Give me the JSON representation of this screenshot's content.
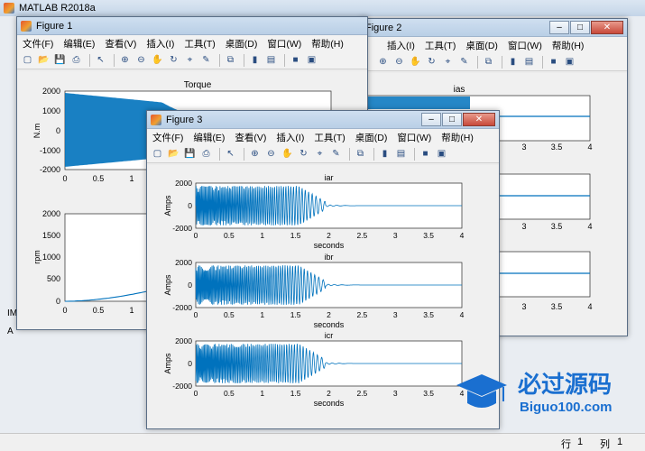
{
  "main_window": {
    "title": "MATLAB R2018a",
    "status": {
      "row_label": "行",
      "row_value": "1",
      "col_label": "列",
      "col_value": "1"
    },
    "side_text_1": "IM",
    "side_text_2": "A"
  },
  "figures": [
    {
      "title": "Figure 1",
      "menus": [
        "文件(F)",
        "编辑(E)",
        "查看(V)",
        "插入(I)",
        "工具(T)",
        "桌面(D)",
        "窗口(W)",
        "帮助(H)"
      ],
      "axes": [
        {
          "title": "Torque",
          "ylabel": "N.m",
          "xlabel": "",
          "yticks": [
            "2000",
            "1000",
            "0",
            "-1000",
            "-2000"
          ],
          "xticks": [
            "0",
            "0.5",
            "1"
          ]
        },
        {
          "title": "",
          "ylabel": "rpm",
          "xlabel": "",
          "yticks": [
            "2000",
            "1500",
            "1000",
            "500",
            "0"
          ],
          "xticks": [
            "0",
            "0.5",
            "1"
          ]
        }
      ]
    },
    {
      "title": "Figure 2",
      "menus": [
        "插入(I)",
        "工具(T)",
        "桌面(D)",
        "窗口(W)",
        "帮助(H)"
      ],
      "axes": [
        {
          "title": "ias",
          "xticks": [
            "3",
            "3.5",
            "4"
          ]
        },
        {
          "title": "",
          "xticks": [
            "3",
            "3.5",
            "4"
          ]
        },
        {
          "title": "",
          "xticks": [
            "3",
            "3.5",
            "4"
          ]
        }
      ]
    },
    {
      "title": "Figure 3",
      "menus": [
        "文件(F)",
        "编辑(E)",
        "查看(V)",
        "插入(I)",
        "工具(T)",
        "桌面(D)",
        "窗口(W)",
        "帮助(H)"
      ],
      "axes": [
        {
          "title": "iar",
          "ylabel": "Amps",
          "xlabel": "seconds",
          "yticks": [
            "2000",
            "0",
            "-2000"
          ],
          "xticks": [
            "0",
            "0.5",
            "1",
            "1.5",
            "2",
            "2.5",
            "3",
            "3.5",
            "4"
          ]
        },
        {
          "title": "ibr",
          "ylabel": "Amps",
          "xlabel": "seconds",
          "yticks": [
            "2000",
            "0",
            "-2000"
          ],
          "xticks": [
            "0",
            "0.5",
            "1",
            "1.5",
            "2",
            "2.5",
            "3",
            "3.5",
            "4"
          ]
        },
        {
          "title": "icr",
          "ylabel": "Amps",
          "xlabel": "seconds",
          "yticks": [
            "2000",
            "0",
            "-2000"
          ],
          "xticks": [
            "0",
            "0.5",
            "1",
            "1.5",
            "2",
            "2.5",
            "3",
            "3.5",
            "4"
          ]
        }
      ]
    }
  ],
  "watermark": {
    "text_cn": "必过源码",
    "text_en": "Biguo100.com"
  },
  "colors": {
    "plot_line": "#0072bd",
    "titlebar": "#c4d5e8",
    "background": "#6f8aa6"
  }
}
